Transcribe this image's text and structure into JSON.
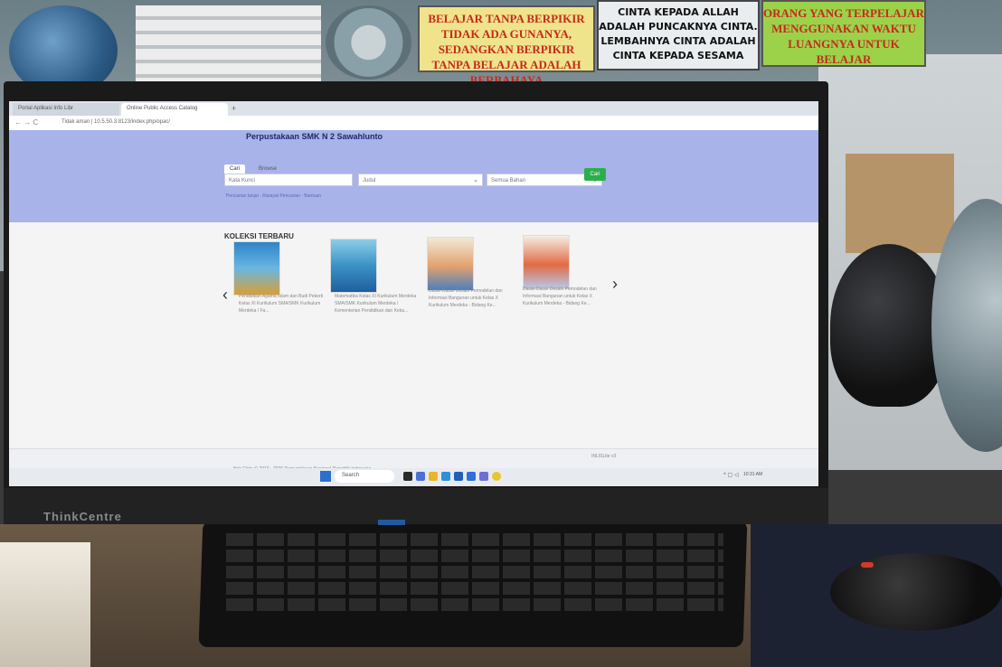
{
  "posters": {
    "left": "BELAJAR TANPA BERPIKIR TIDAK ADA GUNANYA, SEDANGKAN BERPIKIR TANPA BELAJAR ADALAH BERBAHAYA",
    "middle": "CINTA KEPADA ALLAH ADALAH PUNCAKNYA CINTA. LEMBAHNYA CINTA ADALAH CINTA KEPADA SESAMA",
    "right": "ORANG YANG TERPELAJAR MENGGUNAKAN WAKTU LUANGNYA UNTUK BELAJAR"
  },
  "monitor": {
    "brand": "ThinkCentre"
  },
  "browser": {
    "tabs": [
      "Portal Aplikasi Info Libr",
      "Online Public Access Catalog"
    ],
    "new_tab": "+",
    "nav_icons": "← → C",
    "url": "Tidak aman | 10.5.50.3:8123/index.php/opac/"
  },
  "site": {
    "title": "Perpustakaan SMK N 2 Sawahlunto",
    "search_tabs": [
      "Cari",
      "Browse"
    ],
    "search_placeholder": "Kata Kunci",
    "select_field": "Judul",
    "select_material": "Semua Bahan",
    "search_button": "Cari",
    "sub_links": "Pencarian lanjut · Riwayat Pencarian · Bantuan",
    "section_title": "KOLEKSI TERBARU",
    "books": [
      {
        "title": "Pendidikan Agama Islam dan Budi Pekerti Kelas XI Kurikulum SMA/SMK Kurikulum Merdeka / Fa..."
      },
      {
        "title": "Matematika Kelas XI Kurikulum Merdeka SMA/SMK Kurikulum Merdeka / Kementerian Pendidikan dan Kebu..."
      },
      {
        "title": "Dasar-Dasar Desain Pemodelan dan Informasi Bangunan untuk Kelas X Kurikulum Merdeka - Bidang Ke..."
      },
      {
        "title": "Dasar-Dasar Desain Pemodelan dan Informasi Bangunan untuk Kelas X Kurikulum Merdeka - Bidang Ke..."
      }
    ],
    "footer": "Hak Cipta © 2019 - 2026 Perpustakaan Nasional Republik Indonesia",
    "footer_right": "INLISLite v3"
  },
  "taskbar": {
    "search": "Search",
    "tray": "10:31 AM",
    "tray_icons": "^ ▢ ◁"
  },
  "colors": {
    "banner": "#a8b3ea",
    "search_button": "#2ab04a",
    "taskbar": "#e7ebf0"
  }
}
